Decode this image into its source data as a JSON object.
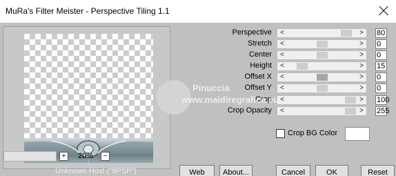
{
  "window": {
    "title": "MuRa's Filter Meister - Perspective Tiling 1.1"
  },
  "zoom": {
    "plus": "+",
    "value": "20%",
    "minus": "−"
  },
  "host": "Unknown Host (\"9PSP\")",
  "params": [
    {
      "label": "Perspective",
      "value": "80"
    },
    {
      "label": "Stretch",
      "value": "0"
    },
    {
      "label": "Center",
      "value": "0"
    },
    {
      "label": "Height",
      "value": "15"
    },
    {
      "label": "Offset X",
      "value": "0"
    },
    {
      "label": "Offset Y",
      "value": "0"
    },
    {
      "label": "Crop",
      "value": "100"
    },
    {
      "label": "Crop Opacity",
      "value": "255"
    }
  ],
  "crop_bg": {
    "label": "Crop BG Color",
    "checked": false,
    "color": "#ffffff"
  },
  "buttons": {
    "web": "Web",
    "about": "About...",
    "cancel": "Cancel",
    "ok": "OK",
    "reset": "Reset"
  },
  "watermark": {
    "title": "Pinuccia",
    "url": "www.maidiregrafica.eu"
  },
  "colors": {
    "background": "#c0c0c0",
    "titlebar": "#ffffff"
  },
  "icons": {
    "close": "close-icon",
    "arrow_left": "arrow-left-icon",
    "arrow_right": "arrow-right-icon"
  }
}
